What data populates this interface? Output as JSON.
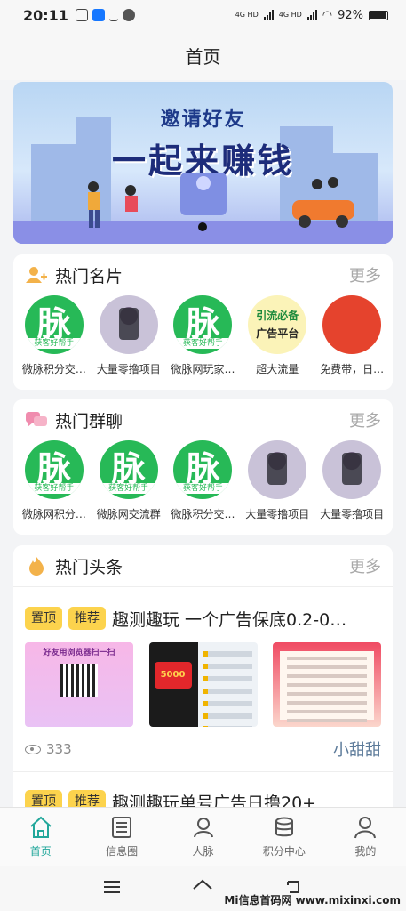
{
  "status": {
    "time": "20:11",
    "battery": "92%",
    "signal1": "4G HD",
    "signal2": "4G HD"
  },
  "header": {
    "title": "首页"
  },
  "banner": {
    "line1": "邀请好友",
    "line2": "一起来赚钱"
  },
  "cards_section": {
    "title": "热门名片",
    "more": "更多",
    "items": [
      {
        "label": "微脉积分交…",
        "avatar": "脉",
        "avatar_sub": "获客好帮手"
      },
      {
        "label": "大量零撸项目"
      },
      {
        "label": "微脉网玩家…",
        "avatar": "脉",
        "avatar_sub": "获客好帮手"
      },
      {
        "label": "超大流量",
        "avatar_l1": "引流必备",
        "avatar_l2": "广告平台"
      },
      {
        "label": "免费带，日…"
      }
    ]
  },
  "groups_section": {
    "title": "热门群聊",
    "more": "更多",
    "items": [
      {
        "label": "微脉网积分…",
        "avatar": "脉",
        "avatar_sub": "获客好帮手"
      },
      {
        "label": "微脉网交流群",
        "avatar": "脉",
        "avatar_sub": "获客好帮手"
      },
      {
        "label": "微脉积分交…",
        "avatar": "脉",
        "avatar_sub": "获客好帮手"
      },
      {
        "label": "大量零撸项目"
      },
      {
        "label": "大量零撸项目"
      }
    ]
  },
  "news_section": {
    "title": "热门头条",
    "more": "更多",
    "posts": [
      {
        "tag1": "置顶",
        "tag2": "推荐",
        "title": "趣测趣玩 一个广告保底0.2-0…",
        "views": "333",
        "author": "小甜甜",
        "thumb1_caption": "好友用浏览器扫一扫",
        "thumb2_caption": "5000"
      },
      {
        "tag1": "置顶",
        "tag2": "推荐",
        "title": "趣测趣玩单号广告日撸20+"
      }
    ]
  },
  "tabbar": {
    "items": [
      {
        "label": "首页",
        "icon": "home-icon",
        "active": true
      },
      {
        "label": "信息圈",
        "icon": "list-icon"
      },
      {
        "label": "人脉",
        "icon": "person-icon"
      },
      {
        "label": "积分中心",
        "icon": "coins-icon"
      },
      {
        "label": "我的",
        "icon": "profile-icon"
      }
    ],
    "active_color": "#22a79b"
  },
  "watermark": "Mi信息首码网 www.mixinxi.com"
}
